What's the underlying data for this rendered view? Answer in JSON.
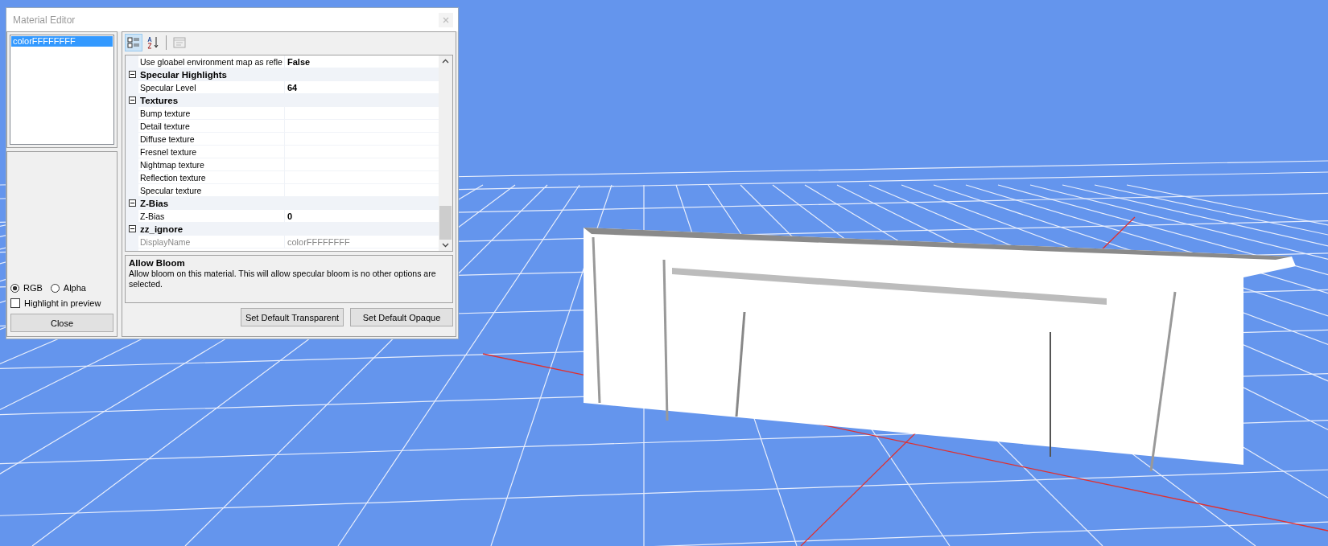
{
  "window": {
    "title": "Material Editor"
  },
  "materials": [
    {
      "label": "colorFFFFFFFF",
      "selected": true
    }
  ],
  "channel_options": [
    {
      "label": "RGB",
      "selected": true
    },
    {
      "label": "Alpha",
      "selected": false
    }
  ],
  "highlight_checkbox": {
    "label": "Highlight in preview",
    "checked": false
  },
  "close_button": "Close",
  "toolbar": [
    {
      "kind": "categorized",
      "selected": true
    },
    {
      "kind": "alphabetical",
      "selected": false
    },
    {
      "kind": "pages",
      "selected": false
    }
  ],
  "properties": [
    {
      "kind": "property",
      "name": "Use gloabel environment map as refle",
      "value": "False",
      "bold": true,
      "disabled": false
    },
    {
      "kind": "category",
      "name": "Specular Highlights",
      "expanded": true
    },
    {
      "kind": "property",
      "name": "Specular Level",
      "value": "64",
      "bold": true,
      "disabled": false
    },
    {
      "kind": "category",
      "name": "Textures",
      "expanded": true
    },
    {
      "kind": "property",
      "name": "Bump texture",
      "disabled": false
    },
    {
      "kind": "property",
      "name": "Detail texture",
      "disabled": false
    },
    {
      "kind": "property",
      "name": "Diffuse texture",
      "disabled": false
    },
    {
      "kind": "property",
      "name": "Fresnel texture",
      "disabled": false
    },
    {
      "kind": "property",
      "name": "Nightmap texture",
      "disabled": false
    },
    {
      "kind": "property",
      "name": "Reflection texture",
      "disabled": false
    },
    {
      "kind": "property",
      "name": "Specular texture",
      "disabled": false
    },
    {
      "kind": "category",
      "name": "Z-Bias",
      "expanded": true
    },
    {
      "kind": "property",
      "name": "Z-Bias",
      "value": "0",
      "bold": true,
      "disabled": false
    },
    {
      "kind": "category",
      "name": "zz_ignore",
      "expanded": true
    },
    {
      "kind": "property",
      "name": "DisplayName",
      "value": "colorFFFFFFFF",
      "bold": false,
      "disabled": true
    }
  ],
  "description": {
    "title": "Allow Bloom",
    "text": "Allow bloom on this material. This will allow specular bloom is no other options are selected."
  },
  "buttons": [
    "Set Default Transparent",
    "Set Default Opaque"
  ]
}
